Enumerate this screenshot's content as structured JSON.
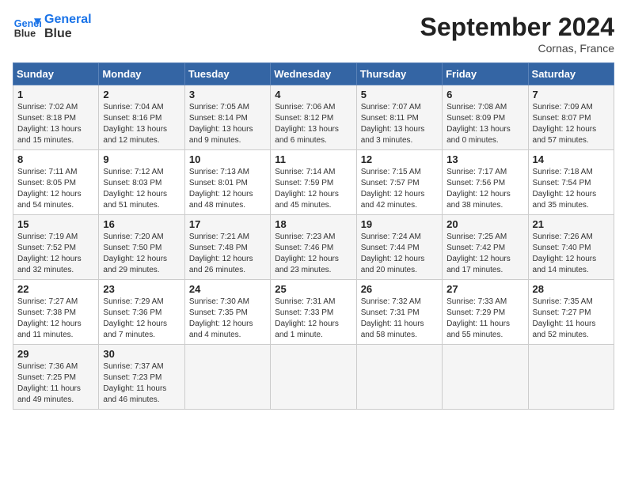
{
  "header": {
    "logo_line1": "General",
    "logo_line2": "Blue",
    "month_title": "September 2024",
    "subtitle": "Cornas, France"
  },
  "weekdays": [
    "Sunday",
    "Monday",
    "Tuesday",
    "Wednesday",
    "Thursday",
    "Friday",
    "Saturday"
  ],
  "weeks": [
    [
      {
        "day": "1",
        "info": "Sunrise: 7:02 AM\nSunset: 8:18 PM\nDaylight: 13 hours and 15 minutes."
      },
      {
        "day": "2",
        "info": "Sunrise: 7:04 AM\nSunset: 8:16 PM\nDaylight: 13 hours and 12 minutes."
      },
      {
        "day": "3",
        "info": "Sunrise: 7:05 AM\nSunset: 8:14 PM\nDaylight: 13 hours and 9 minutes."
      },
      {
        "day": "4",
        "info": "Sunrise: 7:06 AM\nSunset: 8:12 PM\nDaylight: 13 hours and 6 minutes."
      },
      {
        "day": "5",
        "info": "Sunrise: 7:07 AM\nSunset: 8:11 PM\nDaylight: 13 hours and 3 minutes."
      },
      {
        "day": "6",
        "info": "Sunrise: 7:08 AM\nSunset: 8:09 PM\nDaylight: 13 hours and 0 minutes."
      },
      {
        "day": "7",
        "info": "Sunrise: 7:09 AM\nSunset: 8:07 PM\nDaylight: 12 hours and 57 minutes."
      }
    ],
    [
      {
        "day": "8",
        "info": "Sunrise: 7:11 AM\nSunset: 8:05 PM\nDaylight: 12 hours and 54 minutes."
      },
      {
        "day": "9",
        "info": "Sunrise: 7:12 AM\nSunset: 8:03 PM\nDaylight: 12 hours and 51 minutes."
      },
      {
        "day": "10",
        "info": "Sunrise: 7:13 AM\nSunset: 8:01 PM\nDaylight: 12 hours and 48 minutes."
      },
      {
        "day": "11",
        "info": "Sunrise: 7:14 AM\nSunset: 7:59 PM\nDaylight: 12 hours and 45 minutes."
      },
      {
        "day": "12",
        "info": "Sunrise: 7:15 AM\nSunset: 7:57 PM\nDaylight: 12 hours and 42 minutes."
      },
      {
        "day": "13",
        "info": "Sunrise: 7:17 AM\nSunset: 7:56 PM\nDaylight: 12 hours and 38 minutes."
      },
      {
        "day": "14",
        "info": "Sunrise: 7:18 AM\nSunset: 7:54 PM\nDaylight: 12 hours and 35 minutes."
      }
    ],
    [
      {
        "day": "15",
        "info": "Sunrise: 7:19 AM\nSunset: 7:52 PM\nDaylight: 12 hours and 32 minutes."
      },
      {
        "day": "16",
        "info": "Sunrise: 7:20 AM\nSunset: 7:50 PM\nDaylight: 12 hours and 29 minutes."
      },
      {
        "day": "17",
        "info": "Sunrise: 7:21 AM\nSunset: 7:48 PM\nDaylight: 12 hours and 26 minutes."
      },
      {
        "day": "18",
        "info": "Sunrise: 7:23 AM\nSunset: 7:46 PM\nDaylight: 12 hours and 23 minutes."
      },
      {
        "day": "19",
        "info": "Sunrise: 7:24 AM\nSunset: 7:44 PM\nDaylight: 12 hours and 20 minutes."
      },
      {
        "day": "20",
        "info": "Sunrise: 7:25 AM\nSunset: 7:42 PM\nDaylight: 12 hours and 17 minutes."
      },
      {
        "day": "21",
        "info": "Sunrise: 7:26 AM\nSunset: 7:40 PM\nDaylight: 12 hours and 14 minutes."
      }
    ],
    [
      {
        "day": "22",
        "info": "Sunrise: 7:27 AM\nSunset: 7:38 PM\nDaylight: 12 hours and 11 minutes."
      },
      {
        "day": "23",
        "info": "Sunrise: 7:29 AM\nSunset: 7:36 PM\nDaylight: 12 hours and 7 minutes."
      },
      {
        "day": "24",
        "info": "Sunrise: 7:30 AM\nSunset: 7:35 PM\nDaylight: 12 hours and 4 minutes."
      },
      {
        "day": "25",
        "info": "Sunrise: 7:31 AM\nSunset: 7:33 PM\nDaylight: 12 hours and 1 minute."
      },
      {
        "day": "26",
        "info": "Sunrise: 7:32 AM\nSunset: 7:31 PM\nDaylight: 11 hours and 58 minutes."
      },
      {
        "day": "27",
        "info": "Sunrise: 7:33 AM\nSunset: 7:29 PM\nDaylight: 11 hours and 55 minutes."
      },
      {
        "day": "28",
        "info": "Sunrise: 7:35 AM\nSunset: 7:27 PM\nDaylight: 11 hours and 52 minutes."
      }
    ],
    [
      {
        "day": "29",
        "info": "Sunrise: 7:36 AM\nSunset: 7:25 PM\nDaylight: 11 hours and 49 minutes."
      },
      {
        "day": "30",
        "info": "Sunrise: 7:37 AM\nSunset: 7:23 PM\nDaylight: 11 hours and 46 minutes."
      },
      {
        "day": "",
        "info": ""
      },
      {
        "day": "",
        "info": ""
      },
      {
        "day": "",
        "info": ""
      },
      {
        "day": "",
        "info": ""
      },
      {
        "day": "",
        "info": ""
      }
    ]
  ]
}
